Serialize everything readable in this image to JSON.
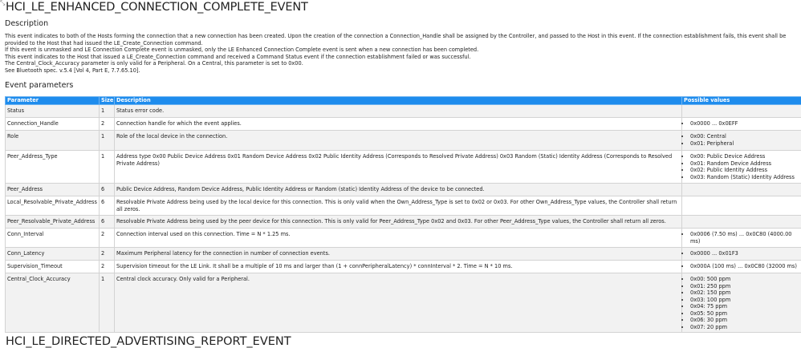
{
  "title": "HCI_LE_ENHANCED_CONNECTION_COMPLETE_EVENT",
  "description_heading": "Description",
  "description_lines": [
    "This event indicates to both of the Hosts forming the connection that a new connection has been created. Upon the creation of the connection a Connection_Handle shall be assigned by the Controller, and passed to the Host in this event. If the connection establishment fails, this event shall be provided to the Host that had issued the LE_Create_Connection command.",
    "If this event is unmasked and LE Connection Complete event is unmasked, only the LE Enhanced Connection Complete event is sent when a new connection has been completed.",
    "This event indicates to the Host that issued a LE_Create_Connection command and received a Command Status event if the connection establishment failed or was successful.",
    "The Central_Clock_Accuracy parameter is only valid for a Peripheral. On a Central, this parameter is set to 0x00.",
    "See Bluetooth spec. v.5.4 [Vol 4, Part E, 7.7.65.10]."
  ],
  "params_heading": "Event parameters",
  "columns": {
    "parameter": "Parameter",
    "size": "Size",
    "description": "Description",
    "values": "Possible values"
  },
  "rows": [
    {
      "parameter": "Status",
      "size": "1",
      "description": "Status error code.",
      "values": []
    },
    {
      "parameter": "Connection_Handle",
      "size": "2",
      "description": "Connection handle for which the event applies.",
      "values": [
        "0x0000 ... 0x0EFF"
      ]
    },
    {
      "parameter": "Role",
      "size": "1",
      "description": "Role of the local device in the connection.",
      "values": [
        "0x00: Central",
        "0x01: Peripheral"
      ]
    },
    {
      "parameter": "Peer_Address_Type",
      "size": "1",
      "description": "Address type 0x00 Public Device Address 0x01 Random Device Address 0x02 Public Identity Address (Corresponds to Resolved Private Address) 0x03 Random (Static) Identity Address (Corresponds to Resolved Private Address)",
      "values": [
        "0x00: Public Device Address",
        "0x01: Random Device Address",
        "0x02: Public Identity Address",
        "0x03: Random (Static) Identity Address"
      ]
    },
    {
      "parameter": "Peer_Address",
      "size": "6",
      "description": "Public Device Address, Random Device Address, Public Identity Address or Random (static) Identity Address of the device to be connected.",
      "values": []
    },
    {
      "parameter": "Local_Resolvable_Private_Address",
      "size": "6",
      "description": "Resolvable Private Address being used by the local device for this connection. This is only valid when the Own_Address_Type is set to 0x02 or 0x03. For other Own_Address_Type values, the Controller shall return all zeros.",
      "values": []
    },
    {
      "parameter": "Peer_Resolvable_Private_Address",
      "size": "6",
      "description": "Resolvable Private Address being used by the peer device for this connection. This is only valid for Peer_Address_Type 0x02 and 0x03. For other Peer_Address_Type values, the Controller shall return all zeros.",
      "values": []
    },
    {
      "parameter": "Conn_Interval",
      "size": "2",
      "description": "Connection interval used on this connection. Time = N * 1.25 ms.",
      "values": [
        "0x0006 (7.50 ms) ... 0x0C80 (4000.00 ms)"
      ]
    },
    {
      "parameter": "Conn_Latency",
      "size": "2",
      "description": "Maximum Peripheral latency for the connection in number of connection events.",
      "values": [
        "0x0000 ... 0x01F3"
      ]
    },
    {
      "parameter": "Supervision_Timeout",
      "size": "2",
      "description": "Supervision timeout for the LE Link. It shall be a multiple of 10 ms and larger than (1 + connPeripheralLatency) * connInterval * 2. Time = N * 10 ms.",
      "values": [
        "0x000A (100 ms) ... 0x0C80 (32000 ms)"
      ]
    },
    {
      "parameter": "Central_Clock_Accuracy",
      "size": "1",
      "description": "Central clock accuracy. Only valid for a Peripheral.",
      "values": [
        "0x00: 500 ppm",
        "0x01: 250 ppm",
        "0x02: 150 ppm",
        "0x03: 100 ppm",
        "0x04: 75 ppm",
        "0x05: 50 ppm",
        "0x06: 30 ppm",
        "0x07: 20 ppm"
      ]
    }
  ],
  "next_title": "HCI_LE_DIRECTED_ADVERTISING_REPORT_EVENT"
}
